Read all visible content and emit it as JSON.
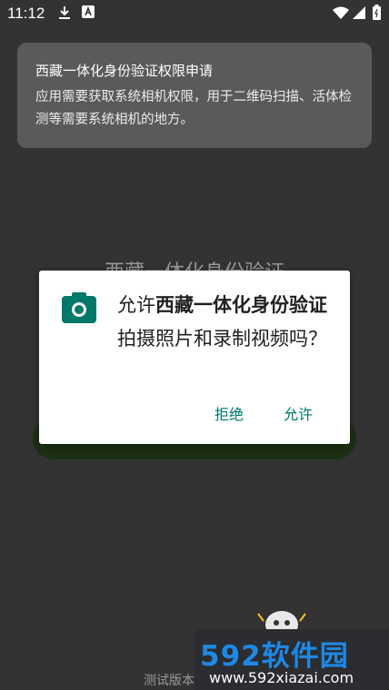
{
  "status_bar": {
    "time": "11:12",
    "icons": [
      "download-icon",
      "a-badge-icon",
      "wifi-icon",
      "cellular-icon",
      "battery-icon"
    ]
  },
  "permission_card": {
    "title": "西藏一体化身份验证权限申请",
    "description": "应用需要获取系统相机权限，用于二维码扫描、活体检测等需要系统相机的地方。"
  },
  "background": {
    "title": "西藏一体化身份验证",
    "footer_text": "测试版本"
  },
  "dialog": {
    "icon": "camera-icon",
    "message_prefix": "允许",
    "app_name": "西藏一体化身份验证",
    "message_suffix": "拍摄照片和录制视频吗？",
    "deny_label": "拒绝",
    "allow_label": "允许",
    "accent_color": "#00796b"
  },
  "watermark": {
    "brand": "592软件园",
    "url": "www.592xiazai.com"
  }
}
